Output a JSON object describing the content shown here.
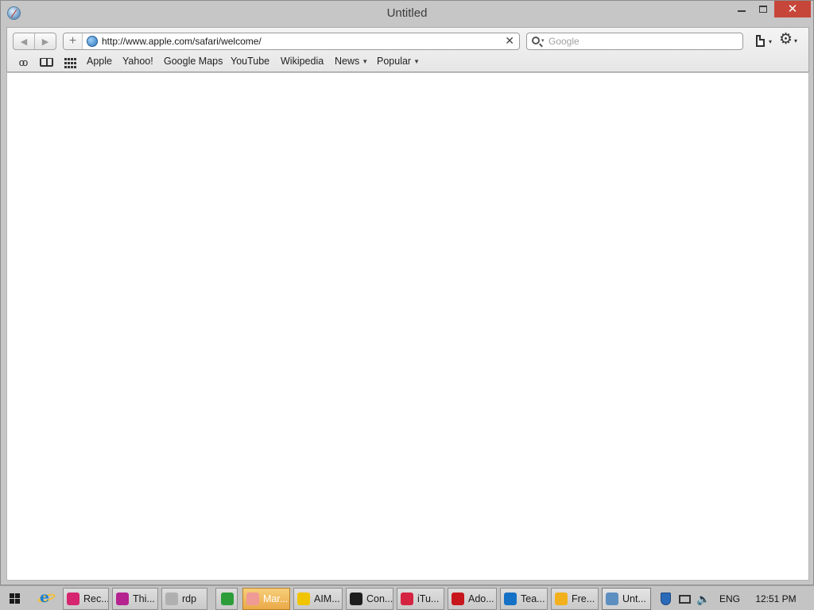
{
  "window": {
    "title": "Untitled",
    "close_glyph": "✕"
  },
  "toolbar": {
    "back_glyph": "◀",
    "forward_glyph": "▶",
    "new_tab_glyph": "+",
    "address_value": "http://www.apple.com/safari/welcome/",
    "clear_glyph": "✕",
    "search_placeholder": "Google",
    "menu_caret": "▾",
    "gear_glyph": "⚙"
  },
  "bookmarks": {
    "items": [
      {
        "label": "Apple"
      },
      {
        "label": "Yahoo!"
      },
      {
        "label": "Google Maps"
      },
      {
        "label": "YouTube"
      },
      {
        "label": "Wikipedia"
      },
      {
        "label": "News",
        "dropdown": true
      },
      {
        "label": "Popular",
        "dropdown": true
      }
    ],
    "caret": "▼",
    "reading_list_glyph": "oo"
  },
  "taskbar": {
    "items": [
      {
        "label": "Rec...",
        "icon": "recorder-icon",
        "color": "#d5266f"
      },
      {
        "label": "Thi...",
        "icon": "thinkfree-icon",
        "color": "#b4238f"
      },
      {
        "label": "rdp",
        "icon": "rdp-icon",
        "color": "#b0b0b0"
      },
      {
        "label": "",
        "icon": "excel-icon",
        "color": "#2c9d39"
      },
      {
        "label": "Mar...",
        "icon": "marker-icon",
        "color": "#f09a96",
        "state": "active"
      },
      {
        "label": "AIM...",
        "icon": "aim-icon",
        "color": "#f0c400"
      },
      {
        "label": "Con...",
        "icon": "console-icon",
        "color": "#1d1d1d"
      },
      {
        "label": "iTu...",
        "icon": "itunes-icon",
        "color": "#d52442"
      },
      {
        "label": "Ado...",
        "icon": "adobe-reader-icon",
        "color": "#c8161d"
      },
      {
        "label": "Tea...",
        "icon": "teamviewer-icon",
        "color": "#1571c5"
      },
      {
        "label": "Fre...",
        "icon": "freemake-icon",
        "color": "#f2b11c"
      },
      {
        "label": "Unt...",
        "icon": "safari-icon",
        "color": "#5c8fc0",
        "state": "current"
      }
    ],
    "tray": {
      "language": "ENG",
      "clock": "12:51 PM",
      "volume_glyph": "🔈"
    }
  }
}
